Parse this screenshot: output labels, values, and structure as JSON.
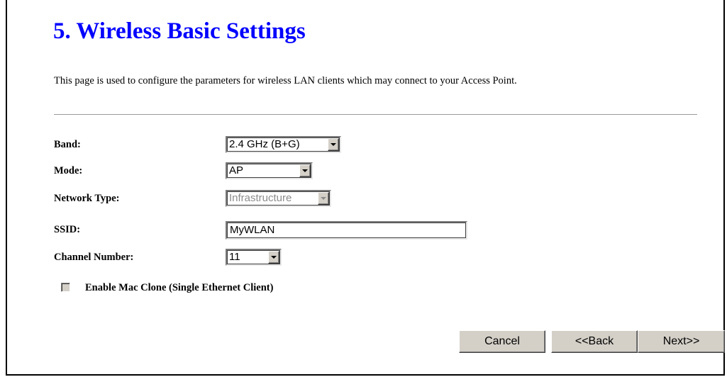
{
  "page": {
    "title": "5. Wireless Basic Settings",
    "description": "This page is used to configure the parameters for wireless LAN clients which may connect to your Access Point."
  },
  "form": {
    "band": {
      "label": "Band:",
      "value": "2.4 GHz (B+G)"
    },
    "mode": {
      "label": "Mode:",
      "value": "AP"
    },
    "network_type": {
      "label": "Network Type:",
      "value": "Infrastructure",
      "disabled": true
    },
    "ssid": {
      "label": "SSID:",
      "value": "MyWLAN"
    },
    "channel": {
      "label": "Channel Number:",
      "value": "11"
    },
    "mac_clone": {
      "label": "Enable Mac Clone (Single Ethernet Client)",
      "checked": false
    }
  },
  "buttons": {
    "cancel": "Cancel",
    "back": "<<Back",
    "next": "Next>>"
  },
  "colors": {
    "title": "#0000ff",
    "button_face": "#d4d0c8",
    "disabled_text": "#8c8c8c"
  }
}
